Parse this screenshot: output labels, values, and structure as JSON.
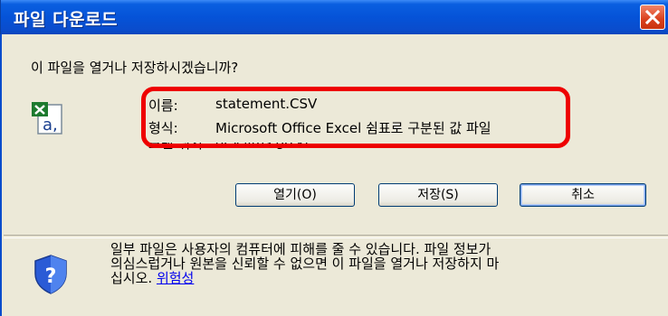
{
  "window": {
    "title": "파일 다운로드"
  },
  "dialog": {
    "question": "이 파일을 열거나 저장하시겠습니까?",
    "file_icon": "excel-csv-file-icon",
    "info": {
      "name_label": "이름:",
      "name_value": "statement.CSV",
      "type_label": "형식:",
      "type_value": "Microsoft Office Excel 쉼표로 구분된 값 파일",
      "from_label": "보낸 위치:",
      "from_value": "dev.lims.go.kr"
    },
    "buttons": {
      "open": "열기(O)",
      "save": "저장(S)",
      "cancel": "취소"
    },
    "warning": {
      "icon": "shield-question-icon",
      "line1": "일부 파일은 사용자의 컴퓨터에 피해를 줄 수 있습니다. 파일 정보가",
      "line2": "의심스럽거나 원본을 신뢰할 수 없으면 이 파일을 열거나 저장하지 마",
      "line3": "십시오.",
      "link": "위험성"
    }
  },
  "colors": {
    "titlebar": "#0553d8",
    "dialog_bg": "#ece9d8",
    "highlight": "#ee0000",
    "link": "#0000ee"
  }
}
